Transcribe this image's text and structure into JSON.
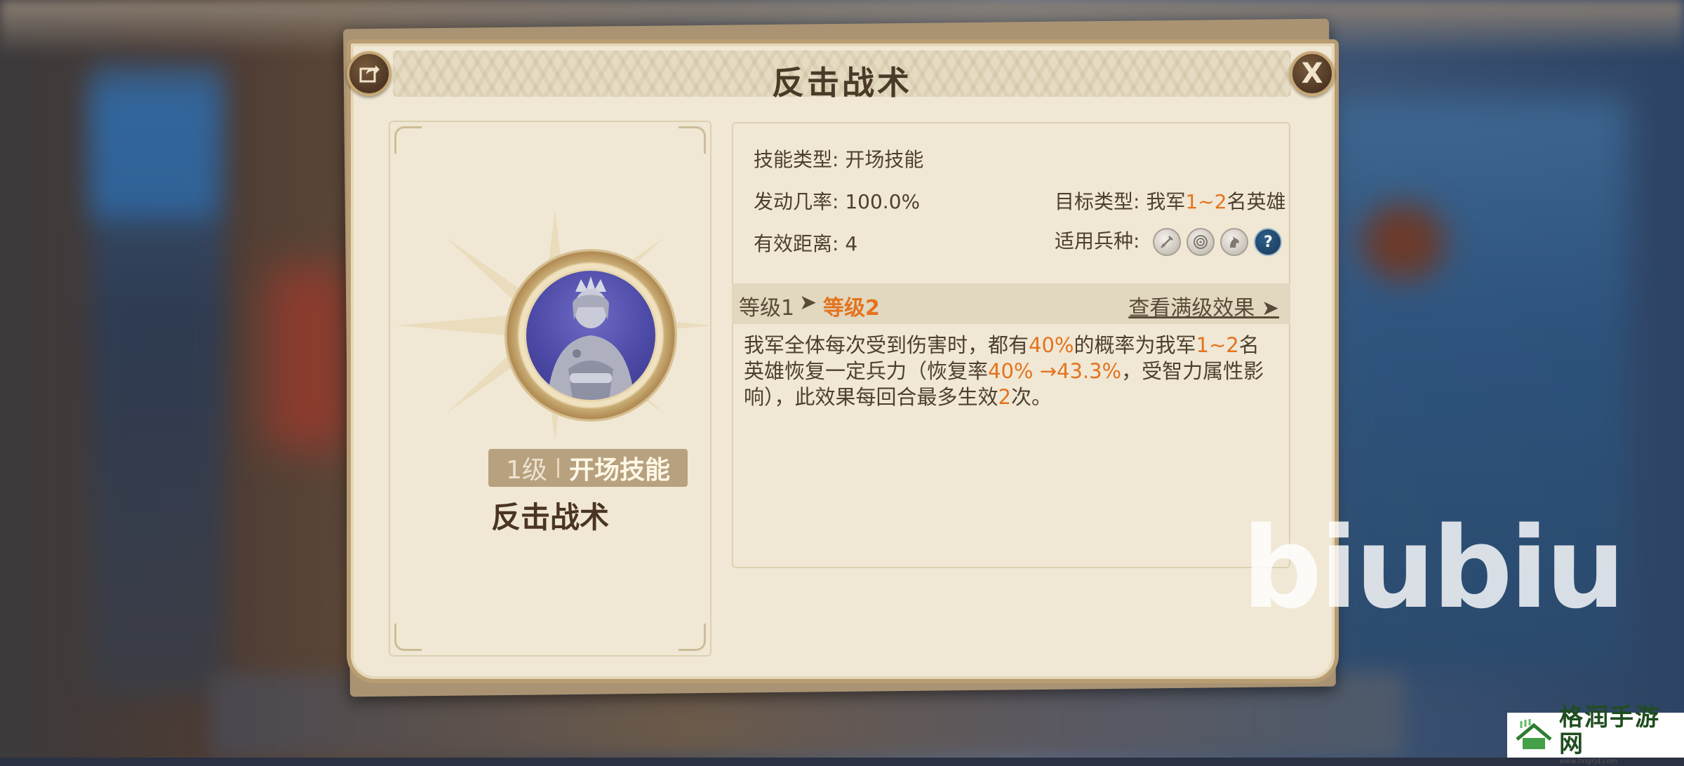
{
  "dialog": {
    "title": "反击战术",
    "close_label": "X"
  },
  "skill": {
    "level": "1级",
    "type": "开场技能",
    "name": "反击战术"
  },
  "stats": {
    "skill_type_label": "技能类型:",
    "skill_type_value": "开场技能",
    "trigger_rate_label": "发动几率:",
    "trigger_rate_value": "100.0%",
    "range_label": "有效距离:",
    "range_value": "4",
    "target_label": "目标类型:",
    "target_prefix": "我军",
    "target_count": "1~2",
    "target_suffix": "名英雄",
    "troops_label": "适用兵种:",
    "troop_icons": [
      "sword-icon",
      "target-icon",
      "horse-icon",
      "question-icon"
    ],
    "troop_unknown_glyph": "?"
  },
  "level_bar": {
    "current": "等级1",
    "arrow": "➤",
    "next": "等级2",
    "full_effect": "查看满级效果",
    "full_arrow": "➤"
  },
  "description": {
    "p1": "我军全体每次受到伤害时，都有",
    "v1": "40%",
    "p2": "的概率为我军",
    "v2": "1~2",
    "p3": "名英雄恢复一定兵力（恢复率",
    "v3": "40% →43.3%",
    "p4": "，受智力属性影响），此效果每回合最多生效",
    "v4": "2",
    "p5": "次。"
  },
  "watermark": {
    "text": "biubiu",
    "site_name": "格润手游网",
    "site_url": "www.hngrjd.com"
  },
  "colors": {
    "highlight": "#e4731f",
    "parchment": "#f0e8d4",
    "frame": "#b89c72"
  }
}
